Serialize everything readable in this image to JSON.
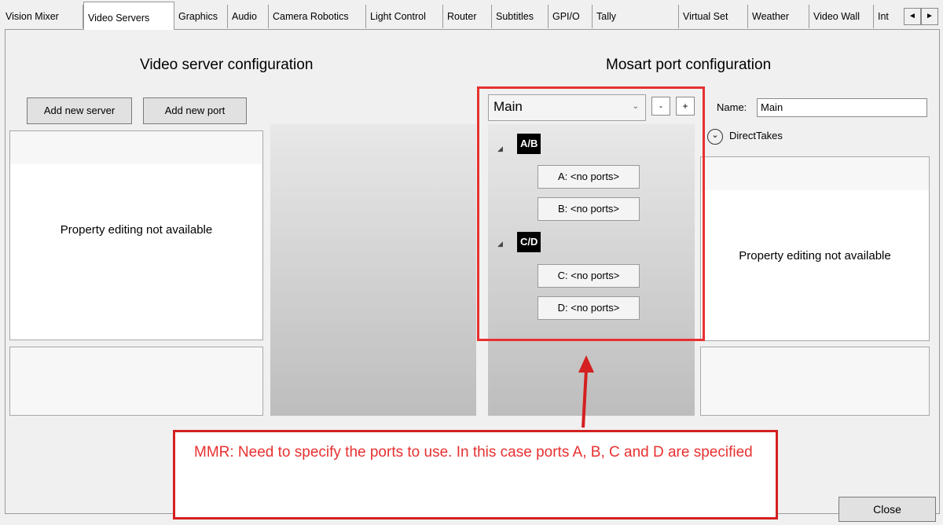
{
  "tabs": [
    {
      "label": "Vision Mixer",
      "active": false
    },
    {
      "label": "Video Servers",
      "active": true
    },
    {
      "label": "Graphics",
      "active": false
    },
    {
      "label": "Audio",
      "active": false
    },
    {
      "label": "Camera Robotics",
      "active": false
    },
    {
      "label": "Light Control",
      "active": false
    },
    {
      "label": "Router",
      "active": false
    },
    {
      "label": "Subtitles",
      "active": false
    },
    {
      "label": "GPI/O",
      "active": false
    },
    {
      "label": "Tally",
      "active": false
    },
    {
      "label": "Virtual Set",
      "active": false
    },
    {
      "label": "Weather",
      "active": false
    },
    {
      "label": "Video Wall",
      "active": false
    },
    {
      "label": "Int",
      "active": false
    }
  ],
  "tab_scroll": {
    "left": "◄",
    "right": "►"
  },
  "left": {
    "heading": "Video server configuration",
    "add_server_label": "Add new server",
    "add_port_label": "Add new port",
    "property_text": "Property editing not available"
  },
  "right": {
    "heading": "Mosart port configuration",
    "selected": "Main",
    "minus_label": "-",
    "plus_label": "+",
    "name_label": "Name:",
    "name_value": "Main",
    "directtakes_label": "DirectTakes",
    "property_text": "Property editing not available"
  },
  "tree": {
    "expander": "◢",
    "groups": [
      {
        "label": "A/B",
        "ports": [
          "A: <no ports>",
          "B: <no ports>"
        ]
      },
      {
        "label": "C/D",
        "ports": [
          "C: <no ports>",
          "D: <no ports>"
        ]
      }
    ]
  },
  "callout_text": "MMR: Need to specify the ports to use. In this case ports A, B, C and D are specified",
  "close_label": "Close",
  "colors": {
    "annotation_red": "#e83030",
    "node_black": "#000000"
  }
}
